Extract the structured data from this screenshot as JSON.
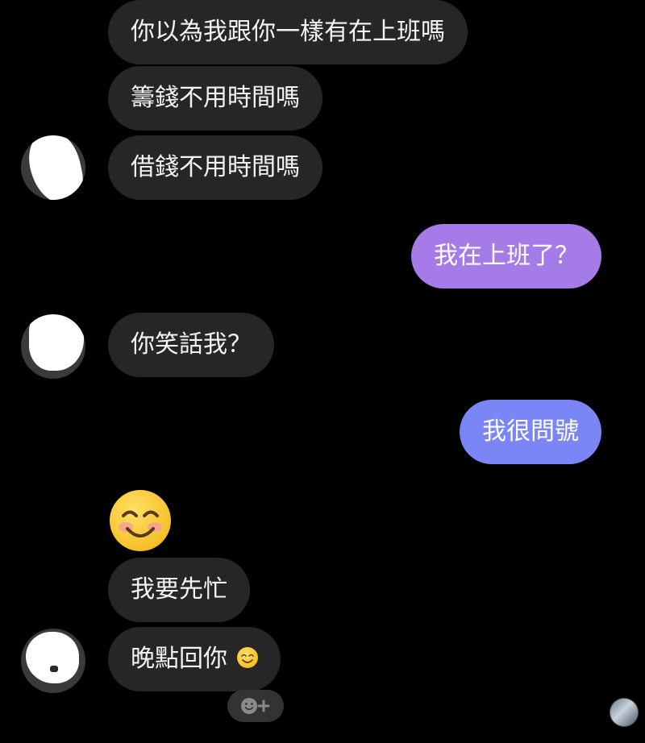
{
  "messages": {
    "m1": "你以為我跟你一樣有在上班嗎",
    "m2": "籌錢不用時間嗎",
    "m3": "借錢不用時間嗎",
    "m4": "我在上班了？",
    "m5": "你笑話我？",
    "m6": "我很問號",
    "m7": "我要先忙",
    "m8": "晚點回你"
  },
  "colors": {
    "background": "#000000",
    "incoming_bubble": "#262626",
    "outgoing_purple": "#a57be8",
    "outgoing_blue": "#7a86f6"
  },
  "icons": {
    "large_emoji": "smiling-face-icon",
    "inline_emoji": "smiling-face-icon",
    "reaction": "add-reaction-icon"
  }
}
